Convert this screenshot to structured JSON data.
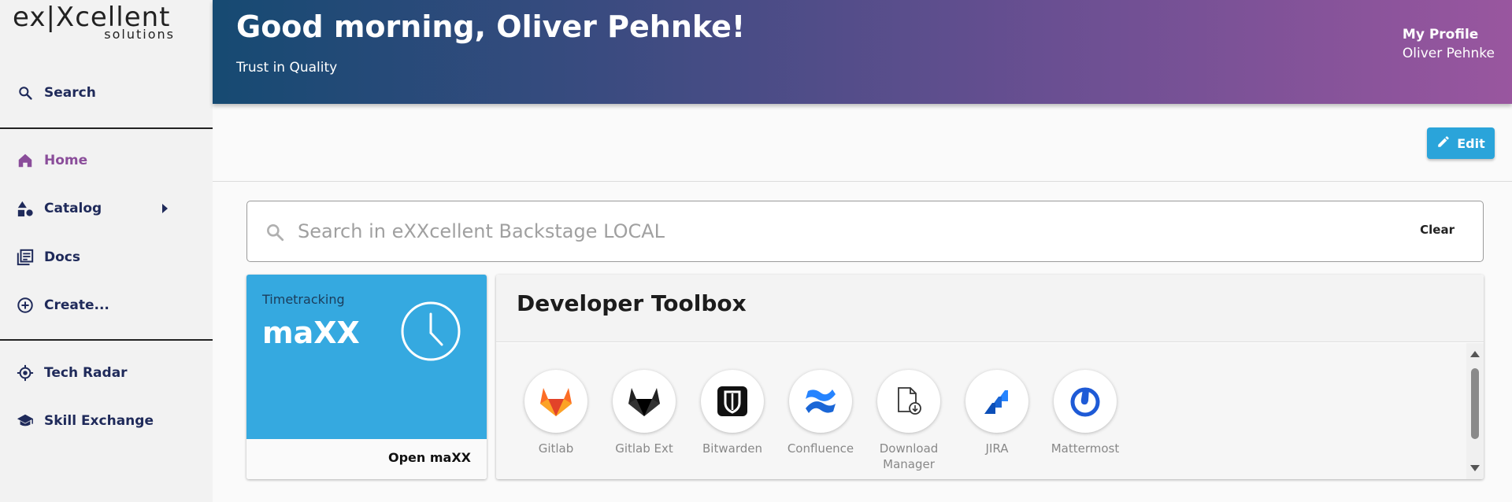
{
  "logo": {
    "main": "ex|Xcellent",
    "sub": "solutions"
  },
  "sidebar": {
    "search": {
      "label": "Search",
      "icon": "search-icon"
    },
    "items": [
      {
        "label": "Home",
        "icon": "home-icon",
        "active": true
      },
      {
        "label": "Catalog",
        "icon": "catalog-icon"
      },
      {
        "label": "Docs",
        "icon": "docs-icon"
      },
      {
        "label": "Create...",
        "icon": "add-circle-icon"
      }
    ],
    "bottom": [
      {
        "label": "Tech Radar",
        "icon": "radar-icon"
      },
      {
        "label": "Skill Exchange",
        "icon": "school-icon"
      }
    ]
  },
  "header": {
    "title": "Good morning, Oliver Pehnke!",
    "subtitle": "Trust in Quality",
    "profile_label": "My Profile",
    "profile_name": "Oliver Pehnke"
  },
  "edit": {
    "label": "Edit"
  },
  "search": {
    "placeholder": "Search in eXXcellent Backstage LOCAL",
    "value": "",
    "clear": "Clear"
  },
  "timetracking": {
    "label": "Timetracking",
    "title": "maXX",
    "action": "Open maXX"
  },
  "toolbox": {
    "title": "Developer Toolbox",
    "tools": [
      {
        "label": "Gitlab",
        "icon": "gitlab-icon"
      },
      {
        "label": "Gitlab Ext",
        "icon": "gitlab-ext-icon"
      },
      {
        "label": "Bitwarden",
        "icon": "bitwarden-icon"
      },
      {
        "label": "Confluence",
        "icon": "confluence-icon"
      },
      {
        "label": "Download Manager",
        "icon": "download-file-icon"
      },
      {
        "label": "JIRA",
        "icon": "jira-icon"
      },
      {
        "label": "Mattermost",
        "icon": "mattermost-icon"
      }
    ]
  },
  "colors": {
    "accent": "#2aa4da",
    "active_nav": "#8a4d9a",
    "nav_text": "#1f2a5a",
    "timetracking_bg": "#35a9e0"
  }
}
